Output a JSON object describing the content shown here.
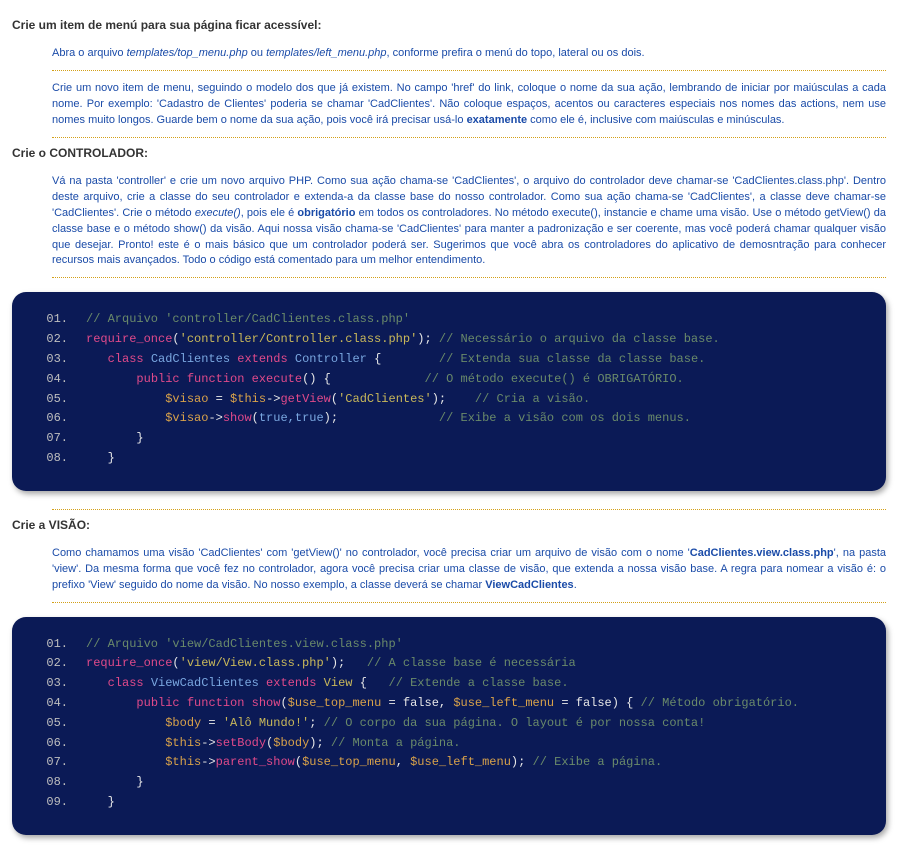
{
  "section1": {
    "heading": "Crie um item de menú para sua página ficar acessível:",
    "note1_a": "Abra o arquivo ",
    "note1_file1": "templates/top_menu.php",
    "note1_b": " ou ",
    "note1_file2": "templates/left_menu.php",
    "note1_c": ", conforme prefira o menú do topo, lateral ou os dois.",
    "note2_a": "Crie um novo item de menu, seguindo o modelo dos que já existem. No campo 'href' do link, coloque o nome da sua ação, lembrando de iniciar por maiúsculas a cada nome. Por exemplo: 'Cadastro de Clientes' poderia se chamar 'CadClientes'. Não coloque espaços, acentos ou caracteres especiais nos nomes das actions, nem use nomes muito longos. Guarde bem o nome da sua ação, pois você irá precisar usá-lo ",
    "note2_em": "exatamente",
    "note2_b": " como ele é, inclusive com maiúsculas e minúsculas."
  },
  "section2": {
    "heading": "Crie o CONTROLADOR:",
    "note_a": "Vá na pasta 'controller' e crie um novo arquivo PHP. Como sua ação chama-se 'CadClientes', o arquivo do controlador deve chamar-se 'CadClientes.class.php'. Dentro deste arquivo, crie a classe do seu controlador e extenda-a da classe base do nosso controlador. Como sua ação chama-se 'CadClientes', a classe deve chamar-se 'CadClientes'. Crie o método ",
    "note_exec": "execute()",
    "note_b": ", pois ele é ",
    "note_em": "obrigatório",
    "note_c": " em todos os controladores. No método execute(), instancie e chame uma visão. Use o método getView() da classe base e o método show() da visão. Aqui nossa visão chama-se 'CadClientes' para manter a padronização e ser coerente, mas você poderá chamar qualquer visão que desejar. Pronto! este é o mais básico que um controlador poderá ser. Sugerimos que você abra os controladores do aplicativo de demosntração para conhecer recursos mais avançados. Todo o código está comentado para um melhor entendimento."
  },
  "code1": {
    "l01": {
      "num": "01.",
      "comment": "// Arquivo 'controller/CadClientes.class.php'"
    },
    "l02": {
      "num": "02.",
      "req": "require_once",
      "p1": "(",
      "str": "'controller/Controller.class.php'",
      "p2": ");",
      "comment": " // Necessário o arquivo da classe base."
    },
    "l03": {
      "num": "03.",
      "kw1": "class",
      "name": " CadClientes ",
      "kw2": "extends",
      "name2": " Controller ",
      "brace": "{",
      "comment": "        // Extenda sua classe da classe base."
    },
    "l04": {
      "num": "04.",
      "kw1": "public ",
      "kw2": "function ",
      "fn": "execute",
      "sig": "() {",
      "comment": "             // O método execute() é OBRIGATÓRIO."
    },
    "l05": {
      "num": "05.",
      "var": "$visao",
      "eq": " = ",
      "this": "$this",
      "arrow": "->",
      "fn": "getView",
      "p1": "(",
      "str": "'CadClientes'",
      "p2": ");",
      "comment": "    // Cria a visão."
    },
    "l06": {
      "num": "06.",
      "var": "$visao",
      "arrow": "->",
      "fn": "show",
      "p1": "(",
      "args": "true,true",
      "p2": ");",
      "comment": "              // Exibe a visão com os dois menus."
    },
    "l07": {
      "num": "07.",
      "brace": "}"
    },
    "l08": {
      "num": "08.",
      "brace": "}"
    }
  },
  "section3": {
    "heading": "Crie a VISÃO:",
    "note_a": "Como chamamos uma visão 'CadClientes' com 'getView()' no controlador, você precisa criar um arquivo de visão com o nome '",
    "note_file": "CadClientes.view.class.php",
    "note_b": "', na pasta 'view'. Da mesma forma que você fez no controlador, agora você precisa criar uma classe de visão, que extenda a nossa visão base. A regra para nomear a visão é: o prefixo 'View' seguido do nome da visão. No nosso exemplo, a classe deverá se chamar ",
    "note_link": "ViewCadClientes",
    "note_c": "."
  },
  "code2": {
    "l01": {
      "num": "01.",
      "comment": "// Arquivo 'view/CadClientes.view.class.php'"
    },
    "l02": {
      "num": "02.",
      "req": "require_once",
      "p1": "(",
      "str": "'view/View.class.php'",
      "p2": ");",
      "comment": "   // A classe base é necessária"
    },
    "l03": {
      "num": "03.",
      "kw1": "class",
      "name": " ViewCadClientes ",
      "kw2": "extends",
      "view": " View ",
      "brace": "{",
      "comment": "   // Extende a classe base."
    },
    "l04": {
      "num": "04.",
      "kw1": "public ",
      "kw2": "function ",
      "fn": "show",
      "p1": "(",
      "v1": "$use_top_menu",
      "eq1": " = false, ",
      "v2": "$use_left_menu",
      "eq2": " = false",
      "p2": ") {",
      "comment": " // Método obrigatório."
    },
    "l05": {
      "num": "05.",
      "var": "$body",
      "eq": " = ",
      "str": "'Alô Mundo!'",
      "semi": ";",
      "comment": " // O corpo da sua página. O layout é por nossa conta!"
    },
    "l06": {
      "num": "06.",
      "this": "$this",
      "arrow": "->",
      "fn": "setBody",
      "p1": "(",
      "var": "$body",
      "p2": ");",
      "comment": " // Monta a página."
    },
    "l07": {
      "num": "07.",
      "this": "$this",
      "arrow": "->",
      "fn": "parent_show",
      "p1": "(",
      "v1": "$use_top_menu",
      "comma": ", ",
      "v2": "$use_left_menu",
      "p2": ");",
      "comment": " // Exibe a página."
    },
    "l08": {
      "num": "08.",
      "brace": "}"
    },
    "l09": {
      "num": "09.",
      "brace": "}"
    }
  }
}
